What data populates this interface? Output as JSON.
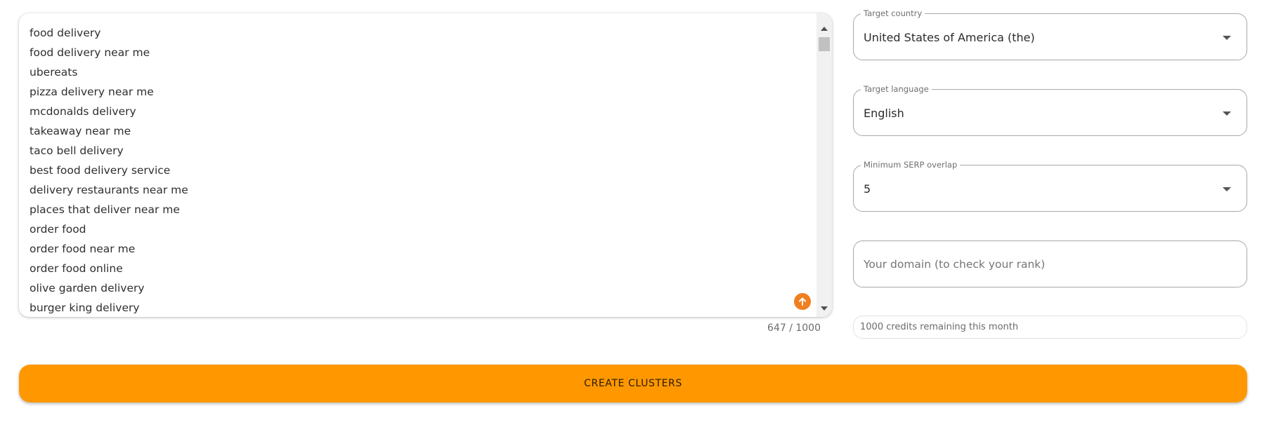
{
  "keywords": {
    "items": [
      "food delivery",
      "food delivery near me",
      "ubereats",
      "pizza delivery near me",
      "mcdonalds delivery",
      "takeaway near me",
      "taco bell delivery",
      "best food delivery service",
      "delivery restaurants near me",
      "places that deliver near me",
      "order food",
      "order food near me",
      "order food online",
      "olive garden delivery",
      "burger king delivery"
    ],
    "counter": "647 / 1000"
  },
  "target_country": {
    "label": "Target country",
    "value": "United States of America (the)"
  },
  "target_language": {
    "label": "Target language",
    "value": "English"
  },
  "min_serp_overlap": {
    "label": "Minimum SERP overlap",
    "value": "5"
  },
  "domain": {
    "placeholder": "Your domain (to check your rank)",
    "value": ""
  },
  "credits": {
    "text": "1000 credits remaining this month"
  },
  "create_button": {
    "label": "CREATE CLUSTERS"
  },
  "colors": {
    "accent": "#ff9800",
    "upload_icon": "#f07f1f",
    "field_border": "#a8a8a8"
  },
  "icons": {
    "upload": "arrow-up-icon",
    "select_caret": "caret-down-icon"
  }
}
